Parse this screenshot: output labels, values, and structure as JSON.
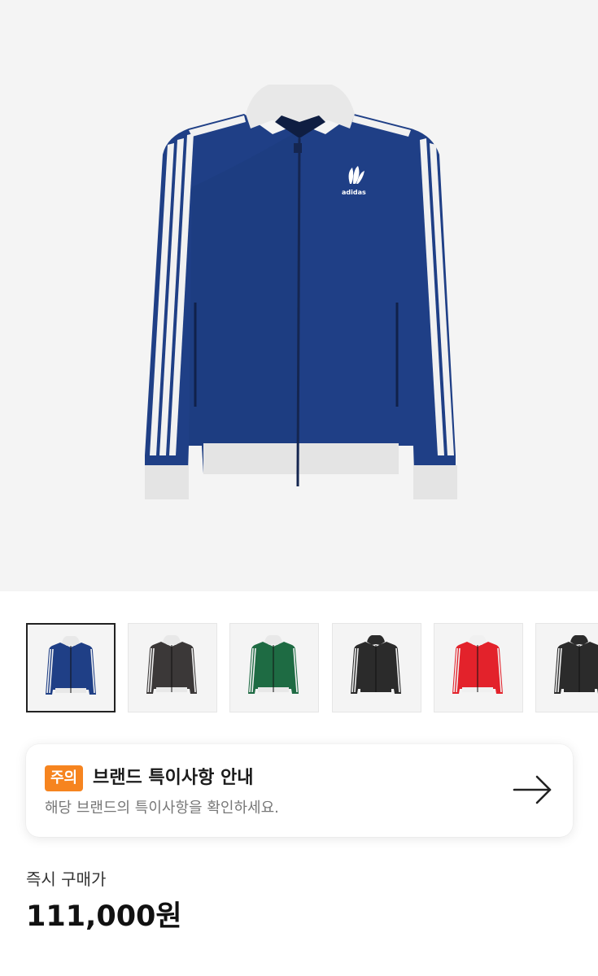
{
  "product": {
    "main_image": {
      "description": "navy track jacket with white collar and three white stripes",
      "color": "#1f3f86"
    },
    "logo_text": "adidas",
    "thumbnails": [
      {
        "color": "#1f3f86",
        "trim": "#e8e8e8",
        "selected": true
      },
      {
        "color": "#3b3838",
        "trim": "#e8e8e8",
        "selected": false
      },
      {
        "color": "#1e6b43",
        "trim": "#e8e8e8",
        "selected": false
      },
      {
        "color": "#2b2b2b",
        "trim": "#2b2b2b",
        "selected": false
      },
      {
        "color": "#e3222b",
        "trim": "#f0f0f0",
        "selected": false
      },
      {
        "color": "#2b2b2b",
        "trim": "#2b2b2b",
        "selected": false
      }
    ]
  },
  "notice": {
    "badge": "주의",
    "title": "브랜드 특이사항 안내",
    "description": "해당 브랜드의 특이사항을 확인하세요.",
    "arrow_icon": "arrow-right-icon",
    "badge_color": "#f6841f"
  },
  "price": {
    "label": "즉시 구매가",
    "value": "111,000원"
  }
}
